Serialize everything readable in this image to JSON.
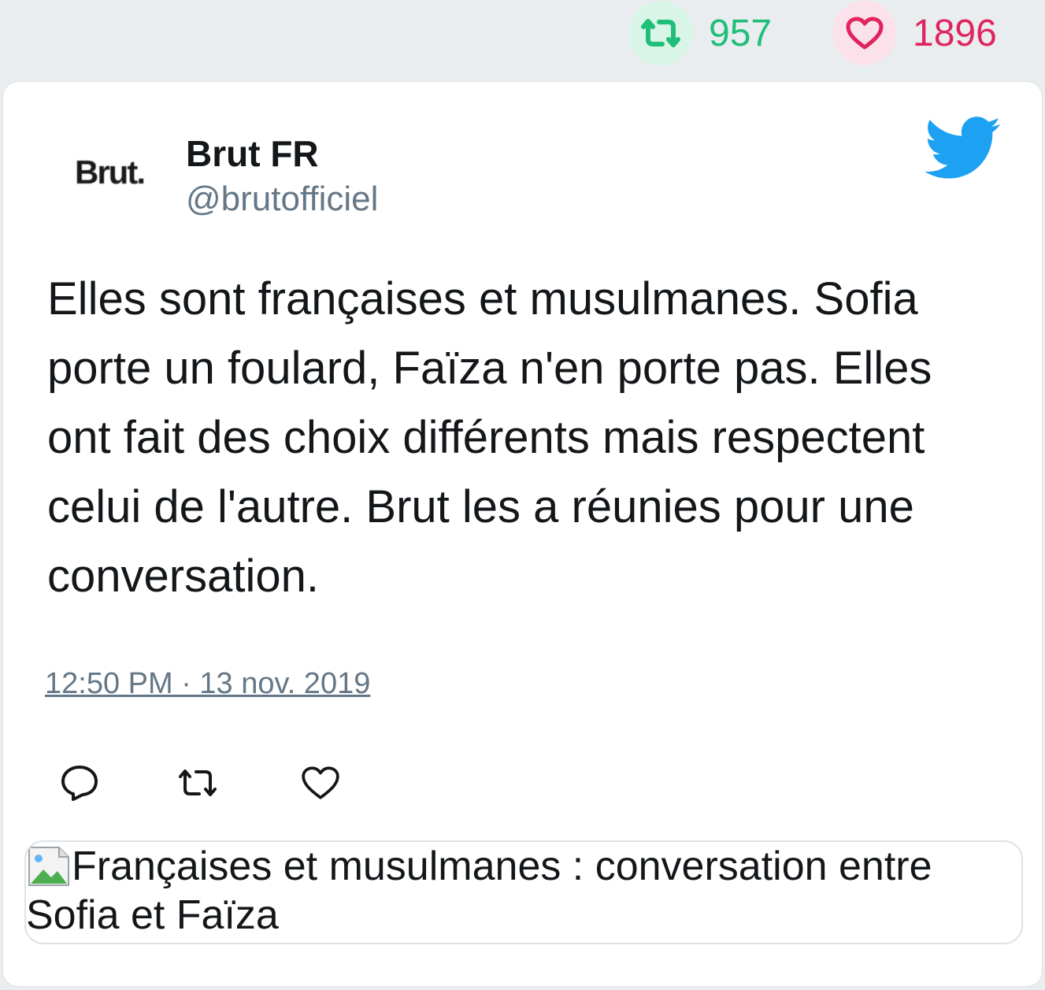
{
  "stats": {
    "retweets": "957",
    "likes": "1896",
    "retweet_color": "#1fbf7a",
    "like_color": "#e0245e"
  },
  "tweet": {
    "avatar_text": "Brut.",
    "name": "Brut FR",
    "handle": "@brutofficiel",
    "text": "Elles sont françaises et musulmanes. Sofia porte un foulard, Faïza n'en porte pas. Elles ont fait des choix différents mais respectent celui de l'autre. Brut les a réunies pour une conversation.",
    "timestamp": "12:50 PM · 13 nov. 2019",
    "brand_icon": "twitter-bird-icon",
    "brand_color": "#1da1f2"
  },
  "actions": {
    "reply_icon": "reply-icon",
    "retweet_icon": "retweet-icon",
    "like_icon": "heart-icon"
  },
  "embed": {
    "alt_text": "Françaises et musulmanes : conversation entre Sofia et Faïza"
  }
}
